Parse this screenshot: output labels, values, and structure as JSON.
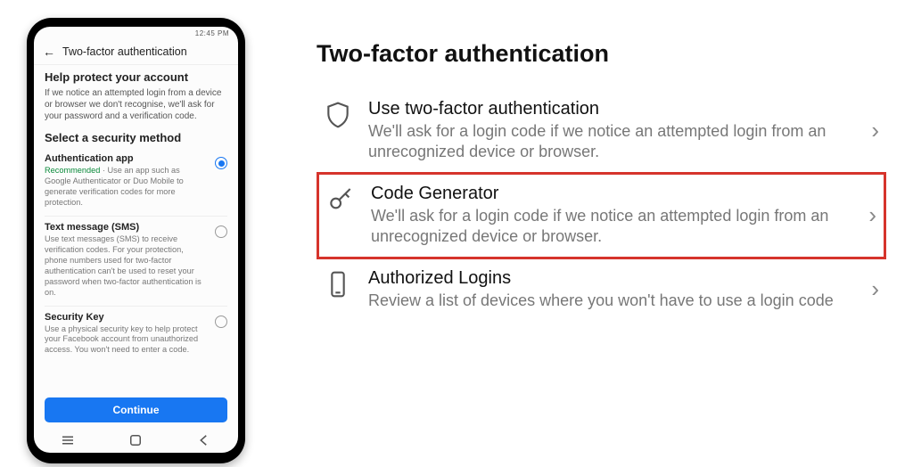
{
  "phone": {
    "statusbar_time": "12:45 PM",
    "header_title": "Two-factor authentication",
    "help_title": "Help protect your account",
    "help_body": "If we notice an attempted login from a device or browser we don't recognise, we'll ask for your password and a verification code.",
    "select_title": "Select a security method",
    "methods": [
      {
        "title": "Authentication app",
        "recommended": "Recommended",
        "desc": " · Use an app such as Google Authenticator or Duo Mobile to generate verification codes for more protection.",
        "selected": true
      },
      {
        "title": "Text message (SMS)",
        "desc": "Use text messages (SMS) to receive verification codes. For your protection, phone numbers used for two-factor authentication can't be used to reset your password when two-factor authentication is on.",
        "selected": false
      },
      {
        "title": "Security Key",
        "desc": "Use a physical security key to help protect your Facebook account from unauthorized access. You won't need to enter a code.",
        "selected": false
      }
    ],
    "continue_label": "Continue"
  },
  "right": {
    "title": "Two-factor authentication",
    "items": [
      {
        "title": "Use two-factor authentication",
        "desc": "We'll ask for a login code if we notice an attempted login from an unrecognized device or browser.",
        "icon": "shield"
      },
      {
        "title": "Code Generator",
        "desc": "We'll ask for a login code if we notice an attempted login from an unrecognized device or browser.",
        "icon": "key",
        "highlight": true
      },
      {
        "title": "Authorized Logins",
        "desc": "Review a list of devices where you won't have to use a login code",
        "icon": "device"
      }
    ]
  }
}
